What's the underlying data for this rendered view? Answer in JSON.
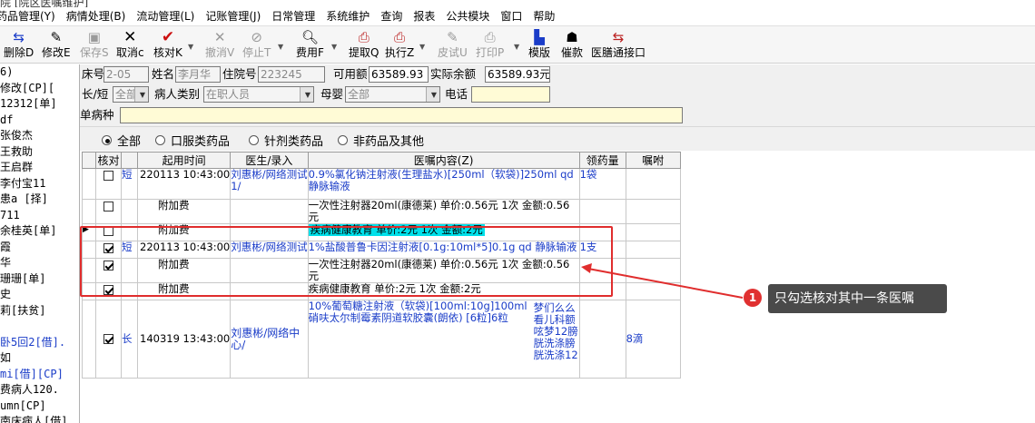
{
  "title_fragment": "院  [院区医嘱维护]",
  "menu": [
    "药品管理(Y)",
    "病情处理(B)",
    "流动管理(L)",
    "记账管理(J)",
    "日常管理",
    "系统维护",
    "查询",
    "报表",
    "公共模块",
    "窗口",
    "帮助"
  ],
  "toolbar": {
    "delete_label": "删除D",
    "edit_label": "修改E",
    "save_label": "保存S",
    "cancel_label": "取消c",
    "verify_label": "核对K",
    "revoke_label": "撤消V",
    "stop_label": "停止T",
    "fee_label": "费用F",
    "withdraw_label": "提取Q",
    "execute_label": "执行Z",
    "skin_test_label": "皮试U",
    "print_label": "打印P",
    "template_label": "模版",
    "urge_label": "催款",
    "meal_label": "医膳通接口"
  },
  "left_list": {
    "items": [
      "6)",
      "修改[CP][",
      "12312[单]",
      "df",
      "张俊杰",
      "王救助",
      "王启群",
      "李付宝11",
      "患a [择]",
      "711",
      "余桂英[单]",
      "霞",
      "华",
      "珊珊[单]",
      "史",
      "莉[扶贫]",
      "",
      "卧5回2[借].",
      "如",
      "mi[借][CP]",
      "费病人120.",
      "umn[CP]",
      "南床病人[借]"
    ]
  },
  "form": {
    "bed_label": "床号",
    "bed_value": "2-05",
    "name_label": "姓名",
    "name_value": "李月华",
    "admit_label": "住院号",
    "admit_value": "223245",
    "avail_label": "可用额",
    "avail_value": "63589.93",
    "actual_label": "实际余额",
    "actual_value": "63589.93元",
    "longshort_label": "长/短",
    "longshort_value": "全部",
    "category_label": "病人类别",
    "category_value": "在职人员",
    "mother_label": "母婴",
    "mother_value": "全部",
    "phone_label": "电话",
    "phone_value": "",
    "disease_label": "单病种",
    "disease_value": ""
  },
  "filter": {
    "all": "全部",
    "oral": "口服类药品",
    "injection": "针剂类药品",
    "non_drug": "非药品及其他"
  },
  "grid": {
    "headers": [
      "核对",
      "起用时间",
      "医生/录入",
      "医嘱内容(Z)",
      "领药量",
      "嘱咐"
    ],
    "rows": [
      {
        "checked": false,
        "type": "短",
        "time": "220113 10:43:00",
        "doctor": "刘惠彬/网络测试1/",
        "content": "0.9%氯化钠注射液(生理盐水)[250ml（软袋)]250ml qd 静脉输液",
        "qty": "1袋",
        "note": ""
      },
      {
        "checked": false,
        "type": "",
        "time": "附加费",
        "doctor": "",
        "content": "一次性注射器20ml(康德莱) 单价:0.56元 1次 金额:0.56元",
        "qty": "",
        "note": ""
      },
      {
        "checked": false,
        "type": "",
        "time": "附加费",
        "doctor": "",
        "content": "疾病健康教育 单价:2元 1次 金额:2元",
        "qty": "",
        "note": ""
      },
      {
        "checked": true,
        "type": "短",
        "time": "220113 10:43:00",
        "doctor": "刘惠彬/网络测试",
        "content": "1%盐酸普鲁卡因注射液[0.1g:10ml*5]0.1g qd 静脉输液",
        "qty": "1支",
        "note": ""
      },
      {
        "checked": true,
        "type": "",
        "time": "附加费",
        "doctor": "",
        "content": "一次性注射器20ml(康德莱) 单价:0.56元 1次 金额:0.56元",
        "qty": "",
        "note": ""
      },
      {
        "checked": true,
        "type": "",
        "time": "附加费",
        "doctor": "",
        "content": "疾病健康教育 单价:2元 1次 金额:2元",
        "qty": "",
        "note": ""
      },
      {
        "checked": true,
        "type": "长",
        "time": "140319 13:43:00",
        "doctor": "刘惠彬/网络中心/",
        "content": "10%葡萄糖注射液（软袋)[100ml:10g]100ml 硝呋太尔制霉素阴道软胶囊(朗依) [6粒]6粒",
        "content_extra": "梦们么么看儿科额呟梦12膀胱洗涤膀胱洗涤12",
        "qty": "",
        "note": "8滴"
      }
    ]
  },
  "annotation": {
    "badge": "1",
    "text": "只勾选核对其中一条医嘱"
  },
  "colors": {
    "highlight": "#00e0ea",
    "red_box": "#e02d2d",
    "callout_bg": "#4a4a4a",
    "blue_text": "#1a3cc8"
  }
}
